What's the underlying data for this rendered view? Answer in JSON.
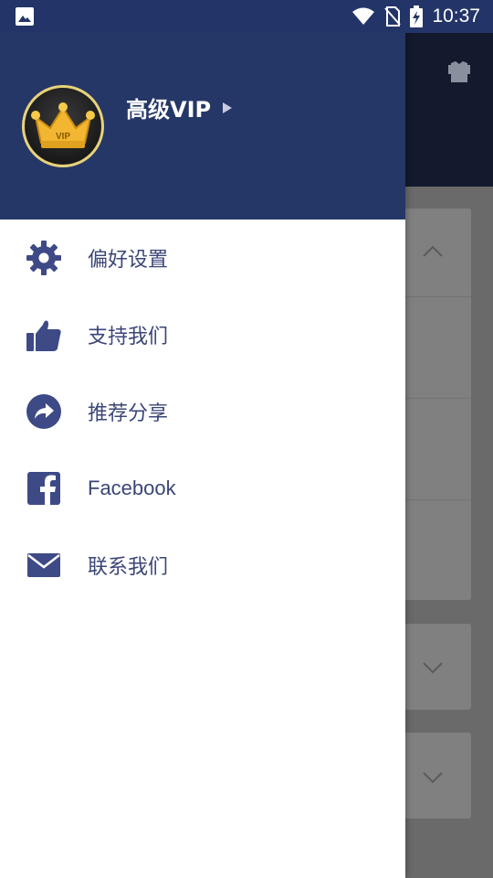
{
  "status_bar": {
    "time": "10:37",
    "icons": [
      "image-notification-icon",
      "wifi-icon",
      "no-sim-icon",
      "battery-charging-icon"
    ]
  },
  "drawer": {
    "header": {
      "avatar_badge": "VIP",
      "title": "高级VIP"
    },
    "items": [
      {
        "id": "preferences",
        "icon": "gear-icon",
        "label": "偏好设置"
      },
      {
        "id": "support",
        "icon": "thumbs-up-icon",
        "label": "支持我们"
      },
      {
        "id": "share",
        "icon": "share-icon",
        "label": "推荐分享"
      },
      {
        "id": "facebook",
        "icon": "facebook-icon",
        "label": "Facebook"
      },
      {
        "id": "contact",
        "icon": "mail-icon",
        "label": "联系我们"
      }
    ]
  },
  "colors": {
    "header_bg": "#253767",
    "accent_icon": "#3e4a86",
    "label_text": "#3b4677"
  }
}
